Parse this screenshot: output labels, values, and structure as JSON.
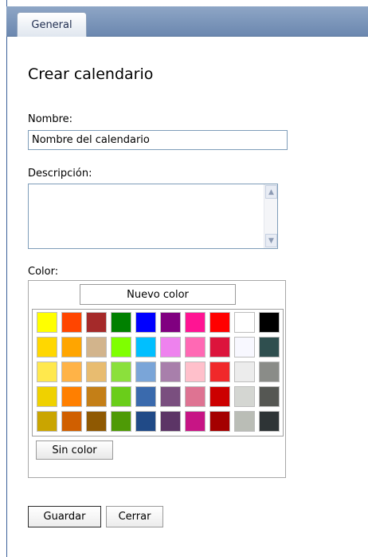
{
  "tabs": {
    "general": "General"
  },
  "form": {
    "title": "Crear calendario",
    "name_label": "Nombre:",
    "name_value": "Nombre del calendario",
    "description_label": "Descripción:",
    "description_value": "",
    "color_label": "Color:"
  },
  "color_picker": {
    "new_color_label": "Nuevo color",
    "no_color_label": "Sin color",
    "swatches": [
      [
        "#ffff00",
        "#ff4500",
        "#a52a2a",
        "#008000",
        "#0000ff",
        "#800080",
        "#ff1493",
        "#ff0000",
        "#ffffff",
        "#000000"
      ],
      [
        "#ffd700",
        "#ffa500",
        "#d2b48c",
        "#7fff00",
        "#00bfff",
        "#ee82ee",
        "#ff69b4",
        "#dc143c",
        "#f8f8ff",
        "#2f4f4f"
      ],
      [
        "#ffe84d",
        "#ffb347",
        "#e8bc70",
        "#8be03c",
        "#7aa5d8",
        "#a87fab",
        "#ffc0cb",
        "#f0282a",
        "#ececec",
        "#8a8c88"
      ],
      [
        "#efd100",
        "#ff7f00",
        "#c47f17",
        "#6acd1a",
        "#3a6aad",
        "#7a4f7f",
        "#de7392",
        "#cc0000",
        "#d4d6d2",
        "#555753"
      ],
      [
        "#caa500",
        "#d05f00",
        "#8f5902",
        "#4e9a06",
        "#204a87",
        "#5c3566",
        "#c71585",
        "#a40000",
        "#babdb6",
        "#2e3436"
      ]
    ]
  },
  "actions": {
    "save_label": "Guardar",
    "close_label": "Cerrar"
  },
  "icons": {
    "scroll_up": "▲",
    "scroll_down": "▼"
  }
}
